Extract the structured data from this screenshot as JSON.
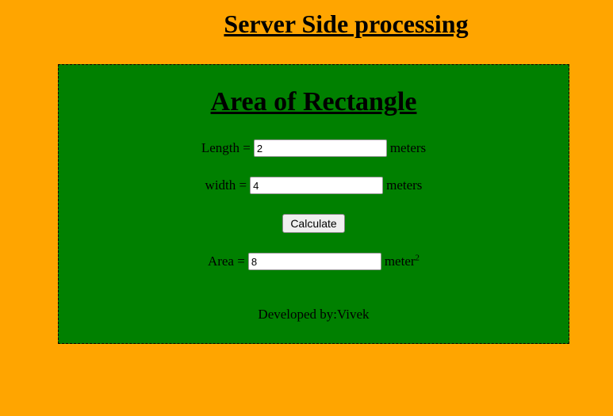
{
  "page": {
    "title": "Server Side processing"
  },
  "panel": {
    "title": "Area of Rectangle",
    "length": {
      "label": "Length =",
      "value": "2",
      "unit": "meters"
    },
    "width": {
      "label": "width =",
      "value": "4",
      "unit": "meters"
    },
    "calculate_label": "Calculate",
    "area": {
      "label": "Area =",
      "value": "8",
      "unit": "meter",
      "unit_exponent": "2"
    },
    "footer": "Developed by:Vivek"
  },
  "colors": {
    "background": "#FFA500",
    "panel": "#008000"
  }
}
